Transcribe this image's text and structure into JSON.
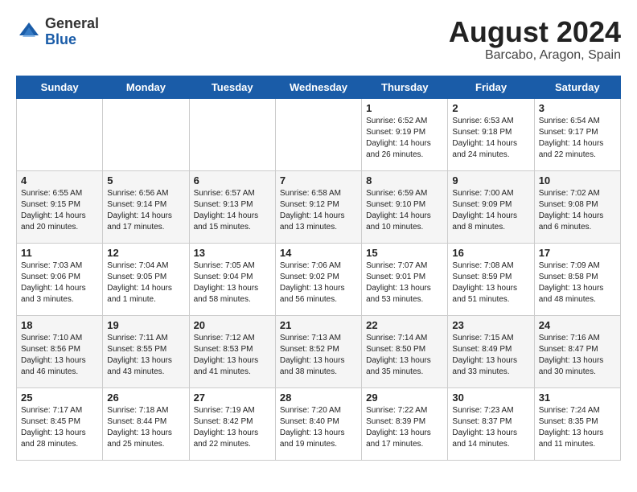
{
  "logo": {
    "general": "General",
    "blue": "Blue"
  },
  "title": {
    "month_year": "August 2024",
    "location": "Barcabo, Aragon, Spain"
  },
  "headers": [
    "Sunday",
    "Monday",
    "Tuesday",
    "Wednesday",
    "Thursday",
    "Friday",
    "Saturday"
  ],
  "weeks": [
    [
      {
        "day": "",
        "info": ""
      },
      {
        "day": "",
        "info": ""
      },
      {
        "day": "",
        "info": ""
      },
      {
        "day": "",
        "info": ""
      },
      {
        "day": "1",
        "info": "Sunrise: 6:52 AM\nSunset: 9:19 PM\nDaylight: 14 hours\nand 26 minutes."
      },
      {
        "day": "2",
        "info": "Sunrise: 6:53 AM\nSunset: 9:18 PM\nDaylight: 14 hours\nand 24 minutes."
      },
      {
        "day": "3",
        "info": "Sunrise: 6:54 AM\nSunset: 9:17 PM\nDaylight: 14 hours\nand 22 minutes."
      }
    ],
    [
      {
        "day": "4",
        "info": "Sunrise: 6:55 AM\nSunset: 9:15 PM\nDaylight: 14 hours\nand 20 minutes."
      },
      {
        "day": "5",
        "info": "Sunrise: 6:56 AM\nSunset: 9:14 PM\nDaylight: 14 hours\nand 17 minutes."
      },
      {
        "day": "6",
        "info": "Sunrise: 6:57 AM\nSunset: 9:13 PM\nDaylight: 14 hours\nand 15 minutes."
      },
      {
        "day": "7",
        "info": "Sunrise: 6:58 AM\nSunset: 9:12 PM\nDaylight: 14 hours\nand 13 minutes."
      },
      {
        "day": "8",
        "info": "Sunrise: 6:59 AM\nSunset: 9:10 PM\nDaylight: 14 hours\nand 10 minutes."
      },
      {
        "day": "9",
        "info": "Sunrise: 7:00 AM\nSunset: 9:09 PM\nDaylight: 14 hours\nand 8 minutes."
      },
      {
        "day": "10",
        "info": "Sunrise: 7:02 AM\nSunset: 9:08 PM\nDaylight: 14 hours\nand 6 minutes."
      }
    ],
    [
      {
        "day": "11",
        "info": "Sunrise: 7:03 AM\nSunset: 9:06 PM\nDaylight: 14 hours\nand 3 minutes."
      },
      {
        "day": "12",
        "info": "Sunrise: 7:04 AM\nSunset: 9:05 PM\nDaylight: 14 hours\nand 1 minute."
      },
      {
        "day": "13",
        "info": "Sunrise: 7:05 AM\nSunset: 9:04 PM\nDaylight: 13 hours\nand 58 minutes."
      },
      {
        "day": "14",
        "info": "Sunrise: 7:06 AM\nSunset: 9:02 PM\nDaylight: 13 hours\nand 56 minutes."
      },
      {
        "day": "15",
        "info": "Sunrise: 7:07 AM\nSunset: 9:01 PM\nDaylight: 13 hours\nand 53 minutes."
      },
      {
        "day": "16",
        "info": "Sunrise: 7:08 AM\nSunset: 8:59 PM\nDaylight: 13 hours\nand 51 minutes."
      },
      {
        "day": "17",
        "info": "Sunrise: 7:09 AM\nSunset: 8:58 PM\nDaylight: 13 hours\nand 48 minutes."
      }
    ],
    [
      {
        "day": "18",
        "info": "Sunrise: 7:10 AM\nSunset: 8:56 PM\nDaylight: 13 hours\nand 46 minutes."
      },
      {
        "day": "19",
        "info": "Sunrise: 7:11 AM\nSunset: 8:55 PM\nDaylight: 13 hours\nand 43 minutes."
      },
      {
        "day": "20",
        "info": "Sunrise: 7:12 AM\nSunset: 8:53 PM\nDaylight: 13 hours\nand 41 minutes."
      },
      {
        "day": "21",
        "info": "Sunrise: 7:13 AM\nSunset: 8:52 PM\nDaylight: 13 hours\nand 38 minutes."
      },
      {
        "day": "22",
        "info": "Sunrise: 7:14 AM\nSunset: 8:50 PM\nDaylight: 13 hours\nand 35 minutes."
      },
      {
        "day": "23",
        "info": "Sunrise: 7:15 AM\nSunset: 8:49 PM\nDaylight: 13 hours\nand 33 minutes."
      },
      {
        "day": "24",
        "info": "Sunrise: 7:16 AM\nSunset: 8:47 PM\nDaylight: 13 hours\nand 30 minutes."
      }
    ],
    [
      {
        "day": "25",
        "info": "Sunrise: 7:17 AM\nSunset: 8:45 PM\nDaylight: 13 hours\nand 28 minutes."
      },
      {
        "day": "26",
        "info": "Sunrise: 7:18 AM\nSunset: 8:44 PM\nDaylight: 13 hours\nand 25 minutes."
      },
      {
        "day": "27",
        "info": "Sunrise: 7:19 AM\nSunset: 8:42 PM\nDaylight: 13 hours\nand 22 minutes."
      },
      {
        "day": "28",
        "info": "Sunrise: 7:20 AM\nSunset: 8:40 PM\nDaylight: 13 hours\nand 19 minutes."
      },
      {
        "day": "29",
        "info": "Sunrise: 7:22 AM\nSunset: 8:39 PM\nDaylight: 13 hours\nand 17 minutes."
      },
      {
        "day": "30",
        "info": "Sunrise: 7:23 AM\nSunset: 8:37 PM\nDaylight: 13 hours\nand 14 minutes."
      },
      {
        "day": "31",
        "info": "Sunrise: 7:24 AM\nSunset: 8:35 PM\nDaylight: 13 hours\nand 11 minutes."
      }
    ]
  ]
}
